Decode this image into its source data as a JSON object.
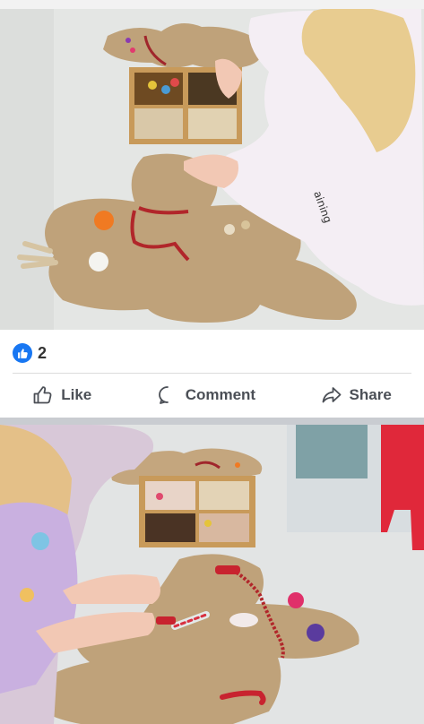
{
  "post": {
    "reactions": {
      "icon": "thumbs-up-badge-icon",
      "count": "2",
      "color": "#1877f2"
    },
    "actions": [
      {
        "label": "Like",
        "icon": "thumbs-up-outline-icon"
      },
      {
        "label": "Comment",
        "icon": "speech-bubble-icon"
      },
      {
        "label": "Share",
        "icon": "share-arrow-icon"
      }
    ]
  }
}
